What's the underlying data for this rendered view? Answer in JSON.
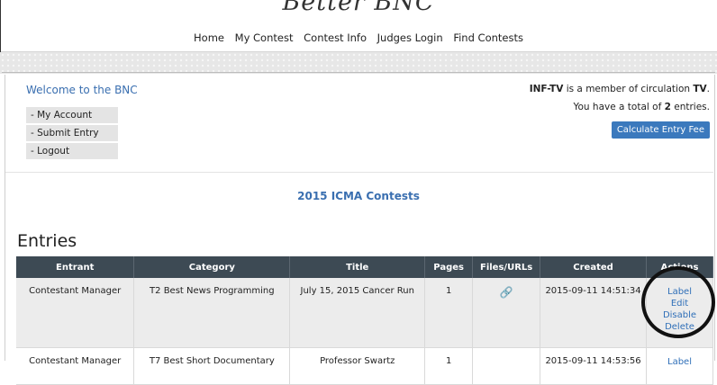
{
  "header": {
    "logo_text": "Better BNC",
    "nav": [
      "Home",
      "My Contest",
      "Contest Info",
      "Judges Login",
      "Find Contests"
    ]
  },
  "welcome": "Welcome to the BNC",
  "side_menu": [
    "- My Account",
    "- Submit Entry",
    "- Logout"
  ],
  "membership": {
    "org": "INF-TV",
    "middle": " is a member of circulation ",
    "circulation": "TV",
    "end": "."
  },
  "entries_total": {
    "prefix": "You have a total of ",
    "count": "2",
    "suffix": " entries."
  },
  "fee_button": "Calculate Entry Fee",
  "contests_title": "2015 ICMA Contests",
  "entries_heading": "Entries",
  "table": {
    "headers": [
      "Entrant",
      "Category",
      "Title",
      "Pages",
      "Files/URLs",
      "Created",
      "Actions"
    ],
    "rows": [
      {
        "entrant": "Contestant Manager",
        "category": "T2 Best News Programming",
        "title": "July 15, 2015 Cancer Run",
        "pages": "1",
        "files_icon": "link-icon",
        "created": "2015-09-11 14:51:34",
        "actions": [
          "Label",
          "Edit",
          "Disable",
          "Delete"
        ]
      },
      {
        "entrant": "Contestant Manager",
        "category": "T7 Best Short Documentary",
        "title": "Professor Swartz",
        "pages": "1",
        "files_icon": "",
        "created": "2015-09-11 14:53:56",
        "actions": [
          "Label"
        ]
      }
    ]
  },
  "colors": {
    "accent": "#3b79bd",
    "table_header": "#3d4a54",
    "link": "#2f6fb8"
  }
}
